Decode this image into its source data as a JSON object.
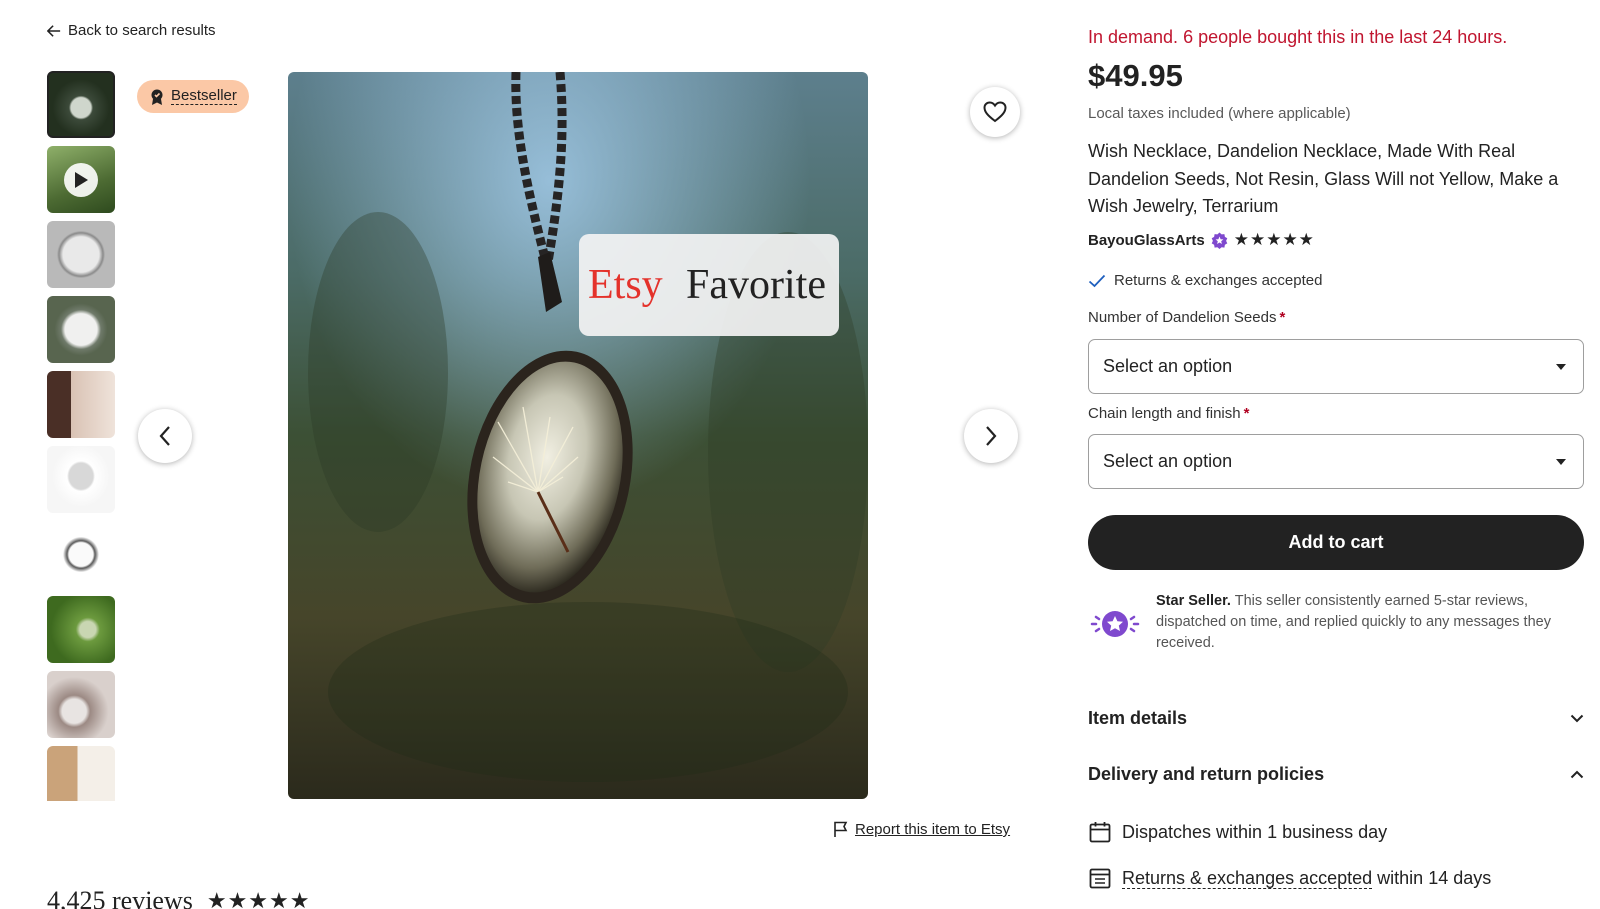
{
  "nav": {
    "back_label": "Back to search results"
  },
  "badge": {
    "label": "Bestseller"
  },
  "image": {
    "overlay_word_1": "Etsy",
    "overlay_word_2": "Favorite"
  },
  "report": {
    "label": "Report this item to Etsy"
  },
  "reviews": {
    "count_label": "4,425 reviews",
    "stars": "★★★★★"
  },
  "listing": {
    "demand": "In demand. 6 people bought this in the last 24 hours.",
    "price": "$49.95",
    "taxes": "Local taxes included (where applicable)",
    "title": "Wish Necklace, Dandelion Necklace, Made With Real Dandelion Seeds, Not Resin, Glass Will not Yellow, Make a Wish Jewelry, Terrarium",
    "shop_name": "BayouGlassArts",
    "shop_stars": "★★★★★",
    "returns": "Returns & exchanges accepted"
  },
  "options": [
    {
      "label": "Number of Dandelion Seeds",
      "required": "*",
      "value": "Select an option"
    },
    {
      "label": "Chain length and finish",
      "required": "*",
      "value": "Select an option"
    }
  ],
  "cart": {
    "label": "Add to cart"
  },
  "star_seller": {
    "title": "Star Seller.",
    "text": "This seller consistently earned 5-star reviews, dispatched on time, and replied quickly to any messages they received."
  },
  "sections": [
    {
      "label": "Item details",
      "state": "collapsed"
    },
    {
      "label": "Delivery and return policies",
      "state": "expanded"
    }
  ],
  "policies": {
    "dispatch": "Dispatches within 1 business day",
    "returns_link": "Returns & exchanges accepted",
    "returns_suffix": "within 14 days"
  },
  "colors": {
    "demand": "#c0152f",
    "badge_bg": "#fbc8a6",
    "star_seller": "#7f49ce",
    "check": "#1e5fbe"
  }
}
